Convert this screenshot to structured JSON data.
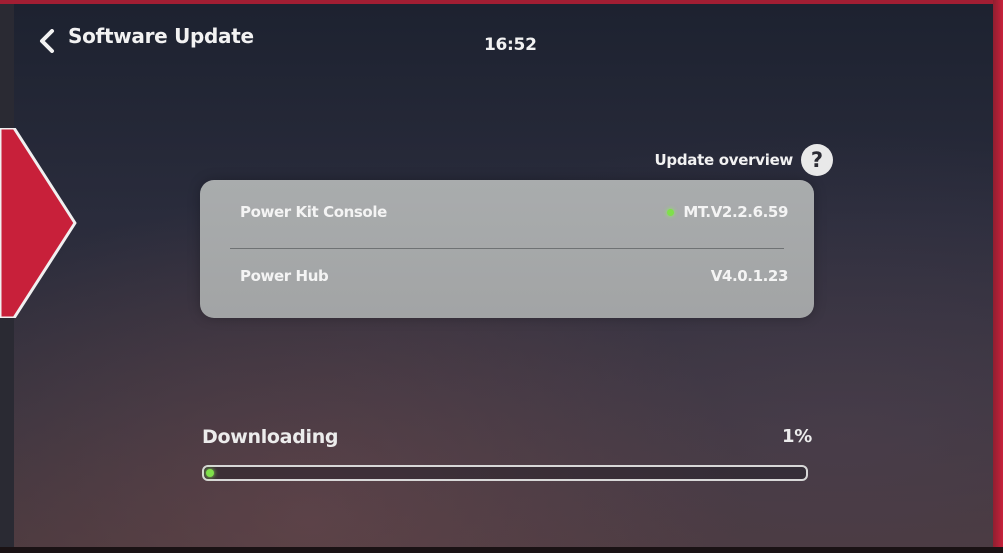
{
  "header": {
    "title": "Software Update",
    "back_icon": "chevron-left-icon",
    "time": "16:52"
  },
  "overview": {
    "label": "Update overview",
    "help_icon": "question-circle-icon",
    "help_glyph": "?"
  },
  "versions": [
    {
      "name": "Power Kit Console",
      "version": "MT.V2.2.6.59",
      "status_dot": true
    },
    {
      "name": "Power Hub",
      "version": "V4.0.1.23",
      "status_dot": false
    }
  ],
  "download": {
    "label": "Downloading",
    "percent_text": "1%",
    "progress": 0.01
  },
  "colors": {
    "accent_green": "#7fe04a",
    "marker_red": "#c8203a",
    "card_bg": "#a9acad",
    "text": "#f2f2f2"
  }
}
